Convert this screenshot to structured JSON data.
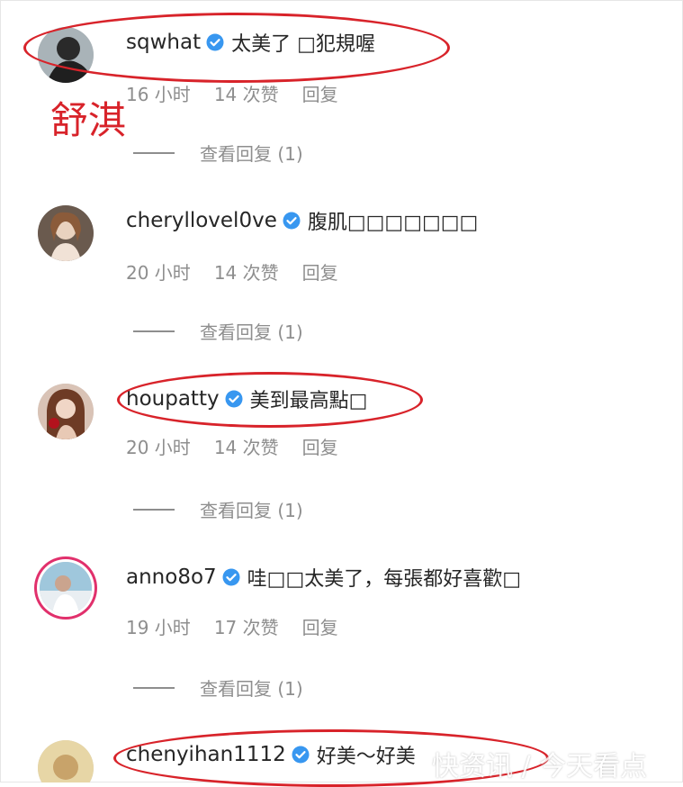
{
  "annotation_label": "舒淇",
  "colors": {
    "verified_blue": "#3897f0",
    "annotation_red": "#d8232a",
    "meta_gray": "#8e8e8e"
  },
  "comments": [
    {
      "username": "sqwhat",
      "text": "太美了 □犯規喔",
      "time": "16 小时",
      "likes": "14 次赞",
      "reply": "回复",
      "view_replies": "查看回复 (1)"
    },
    {
      "username": "cheryllovel0ve",
      "text": "腹肌□□□□□□□",
      "time": "20 小时",
      "likes": "14 次赞",
      "reply": "回复",
      "view_replies": "查看回复 (1)"
    },
    {
      "username": "houpatty",
      "text": "美到最高點□",
      "time": "20 小时",
      "likes": "14 次赞",
      "reply": "回复",
      "view_replies": "查看回复 (1)"
    },
    {
      "username": "anno8o7",
      "text": "哇□□太美了，每張都好喜歡□",
      "time": "19 小时",
      "likes": "17 次赞",
      "reply": "回复",
      "view_replies": "查看回复 (1)"
    },
    {
      "username": "chenyihan1112",
      "text": "好美～好美"
    }
  ],
  "watermark": "快资讯 / 今天看点"
}
